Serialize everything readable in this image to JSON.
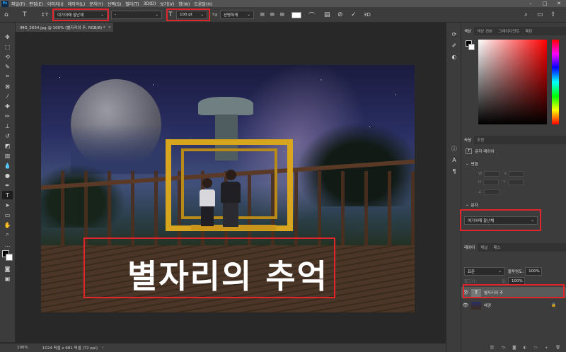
{
  "menubar": {
    "logo": "Ps",
    "items": [
      "파일(F)",
      "편집(E)",
      "이미지(I)",
      "레이어(L)",
      "문자(Y)",
      "선택(S)",
      "필터(T)",
      "3D(D)",
      "보기(V)",
      "창(W)",
      "도움말(H)"
    ]
  },
  "options": {
    "font_family": "여기어때 잘난체",
    "font_style": "-",
    "font_size": "100 pt",
    "antialias": "선명하게",
    "highlight_color": "#e0262b"
  },
  "document": {
    "tab_title": "IMG_2634.jpg @ 100% (별자리의 추, RGB/8) *",
    "overlay_text": "별자리의 추억"
  },
  "status": {
    "zoom": "100%",
    "info": "1024 픽셀 x 681 픽셀 (72 ppi)"
  },
  "color_panel": {
    "tabs": [
      "색상",
      "색상 견본",
      "그레이디언트",
      "패턴"
    ]
  },
  "properties_panel": {
    "tabs": [
      "속성",
      "조정"
    ],
    "layer_type": "문자 레이어",
    "transform_label": "변형",
    "character_label": "문자",
    "font_value": "여기어때 잘난체"
  },
  "layers_panel": {
    "tabs": [
      "레이어",
      "채널",
      "패스"
    ],
    "blend_mode": "표준",
    "opacity_label": "불투명도:",
    "opacity_value": "100%",
    "lock_label": "잠그기:",
    "fill_label": "칠:",
    "fill_value": "100%",
    "layers": [
      {
        "name": "별자리의 추",
        "type": "text",
        "selected": true
      },
      {
        "name": "배경",
        "type": "image",
        "selected": false
      }
    ]
  }
}
